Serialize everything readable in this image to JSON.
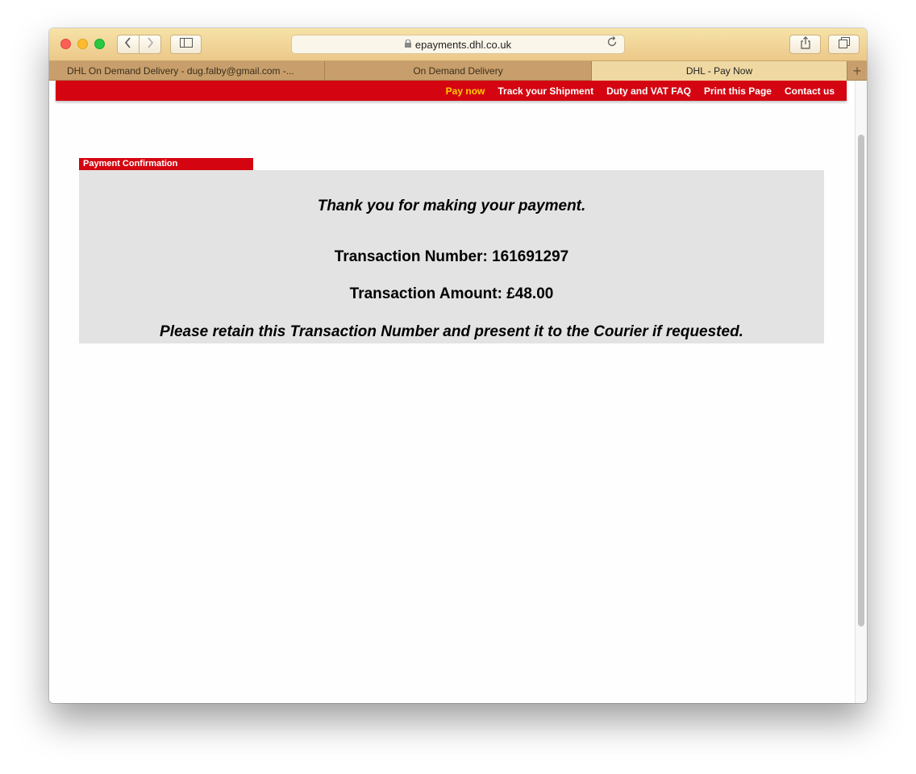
{
  "browser": {
    "address": "epayments.dhl.co.uk",
    "icons": {
      "back": "chevron-left-icon",
      "forward": "chevron-right-icon",
      "sidebar": "sidebar-icon",
      "lock": "lock-icon",
      "reload": "reload-icon",
      "share": "share-icon",
      "tabs": "tabs-overview-icon",
      "new_tab": "plus-icon"
    },
    "tabs": [
      {
        "label": "DHL On Demand Delivery - dug.falby@gmail.com -...",
        "active": false
      },
      {
        "label": "On Demand Delivery",
        "active": false
      },
      {
        "label": "DHL - Pay Now",
        "active": true
      }
    ],
    "new_tab_label": "+"
  },
  "nav": {
    "links": [
      {
        "label": "Pay now",
        "active": true
      },
      {
        "label": "Track your Shipment",
        "active": false
      },
      {
        "label": "Duty and VAT FAQ",
        "active": false
      },
      {
        "label": "Print this Page",
        "active": false
      },
      {
        "label": "Contact us",
        "active": false
      }
    ]
  },
  "confirmation": {
    "section_title": "Payment Confirmation",
    "thanks": "Thank you for making your payment.",
    "transaction_number": "Transaction Number: 161691297",
    "transaction_amount": "Transaction Amount: £48.00",
    "retain_note": "Please retain this Transaction Number and present it to the Courier if requested."
  },
  "colors": {
    "brand_red": "#d40511",
    "nav_active": "#ffcc00",
    "panel_gray": "#e3e3e3"
  }
}
